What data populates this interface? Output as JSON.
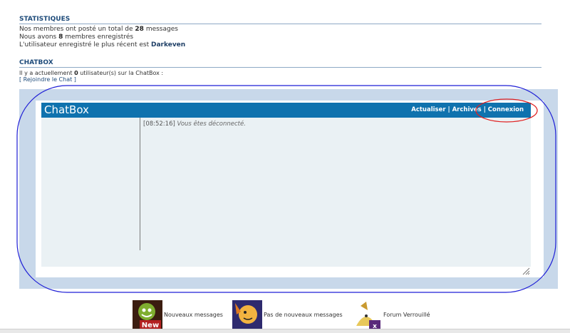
{
  "stats": {
    "title": "STATISTIQUES",
    "posts_prefix": "Nos membres ont posté un total de ",
    "posts_count": "28",
    "posts_suffix": " messages",
    "members_prefix": "Nous avons ",
    "members_count": "8",
    "members_suffix": " membres enregistrés",
    "latest_prefix": "L'utilisateur enregistré le plus récent est ",
    "latest_user": "Darkeven"
  },
  "chatbox_section": {
    "title": "CHATBOX",
    "online_prefix": "Il y a actuellement ",
    "online_count": "0",
    "online_suffix": " utilisateur(s) sur la ChatBox :",
    "join_link": "[ Rejoindre le Chat ]"
  },
  "chatbox": {
    "title": "ChatBox",
    "actions": {
      "refresh": "Actualiser",
      "archives": "Archives",
      "connect": "Connexion",
      "separator": " | "
    },
    "message": {
      "time": "[08:52:16]",
      "text": "Vous êtes déconnecté."
    }
  },
  "legend": {
    "new_messages": "Nouveaux messages",
    "no_new_messages": "Pas de nouveaux messages",
    "locked": "Forum Verrouillé",
    "new_badge": "New"
  },
  "colors": {
    "header_blue": "#0f72ae",
    "panel_bg": "#c8d8ea",
    "body_bg": "#eaf1f4",
    "annotation_blue": "#1f1fd6",
    "annotation_red": "#e02020"
  }
}
